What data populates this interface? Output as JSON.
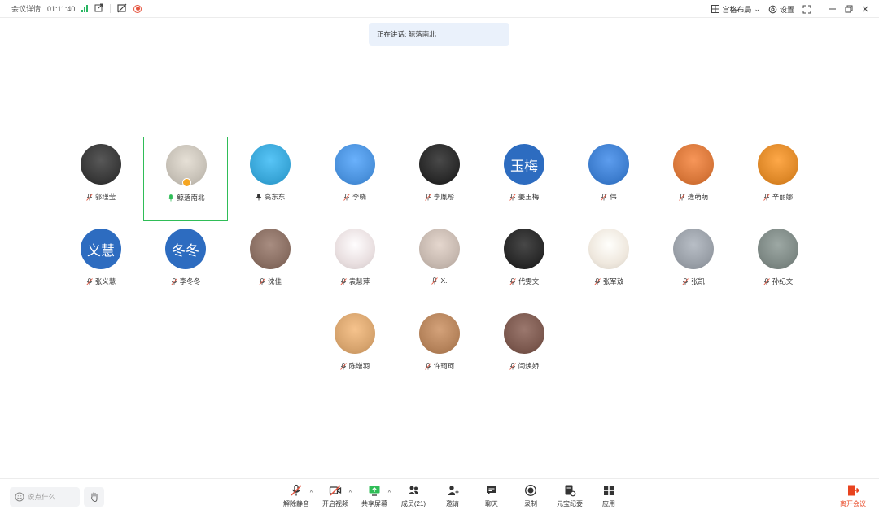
{
  "topbar": {
    "meeting_details": "会议详情",
    "timer": "01:11:40",
    "layout_label": "宫格布局",
    "settings_label": "设置"
  },
  "speaking_banner": "正在讲话: 鲸落南北",
  "participants": [
    {
      "name": "郭瑾莹",
      "type": "photo",
      "color": "#3a3a3a",
      "mic": "muted"
    },
    {
      "name": "鲸落南北",
      "type": "photo",
      "color": "#c8c2b8",
      "mic": "active",
      "host": true,
      "highlight": true
    },
    {
      "name": "高东东",
      "type": "photo",
      "color": "#3aa7d9",
      "mic": "on"
    },
    {
      "name": "李晓",
      "type": "photo",
      "color": "#4c93de",
      "mic": "muted"
    },
    {
      "name": "李胤彤",
      "type": "photo",
      "color": "#2b2b2b",
      "mic": "muted"
    },
    {
      "name": "姜玉梅",
      "type": "text",
      "text": "玉梅",
      "mic": "muted"
    },
    {
      "name": "伟",
      "type": "photo",
      "color": "#3f7fd0",
      "mic": "muted"
    },
    {
      "name": "逄萌萌",
      "type": "photo",
      "color": "#d9783b",
      "mic": "muted"
    },
    {
      "name": "辛丽娜",
      "type": "photo",
      "color": "#e08a2a",
      "mic": "muted"
    },
    {
      "name": "张义慧",
      "type": "text",
      "text": "义慧",
      "mic": "muted"
    },
    {
      "name": "李冬冬",
      "type": "text",
      "text": "冬冬",
      "mic": "muted"
    },
    {
      "name": "沈佳",
      "type": "photo",
      "color": "#8a6f63",
      "mic": "muted"
    },
    {
      "name": "袁慧萍",
      "type": "photo",
      "color": "#e9dfe0",
      "mic": "muted"
    },
    {
      "name": "X.",
      "type": "photo",
      "color": "#c7b9b0",
      "mic": "muted"
    },
    {
      "name": "代雯文",
      "type": "photo",
      "color": "#2a2a2a",
      "mic": "muted"
    },
    {
      "name": "张军敖",
      "type": "photo",
      "color": "#efe8de",
      "mic": "muted"
    },
    {
      "name": "张凯",
      "type": "photo",
      "color": "#9aa0a8",
      "mic": "muted"
    },
    {
      "name": "孙纪文",
      "type": "photo",
      "color": "#7f8a86",
      "mic": "muted"
    },
    {
      "name": "陈增羽",
      "type": "photo",
      "color": "#d8a56f",
      "mic": "muted"
    },
    {
      "name": "许珂珂",
      "type": "photo",
      "color": "#b6845c",
      "mic": "muted"
    },
    {
      "name": "闫焕娇",
      "type": "photo",
      "color": "#7d5a50",
      "mic": "muted"
    }
  ],
  "bottombar": {
    "chat_placeholder": "说点什么...",
    "tools": [
      {
        "label": "解除静音",
        "icon": "mic-muted-icon",
        "caret": true
      },
      {
        "label": "开启视频",
        "icon": "video-off-icon",
        "caret": true
      },
      {
        "label": "共享屏幕",
        "icon": "share-screen-icon",
        "caret": true
      },
      {
        "label": "成员(21)",
        "icon": "members-icon",
        "caret": false
      },
      {
        "label": "邀请",
        "icon": "invite-icon",
        "caret": false
      },
      {
        "label": "聊天",
        "icon": "chat-icon",
        "caret": false
      },
      {
        "label": "录制",
        "icon": "record-icon",
        "caret": false
      },
      {
        "label": "元宝纪要",
        "icon": "notes-icon",
        "caret": false
      },
      {
        "label": "应用",
        "icon": "apps-icon",
        "caret": false
      }
    ],
    "leave_label": "离开会议"
  },
  "colors": {
    "accent": "#2d6cc0",
    "active_border": "#2fbd57",
    "leave": "#e8431f",
    "muted": "#e5533d"
  }
}
